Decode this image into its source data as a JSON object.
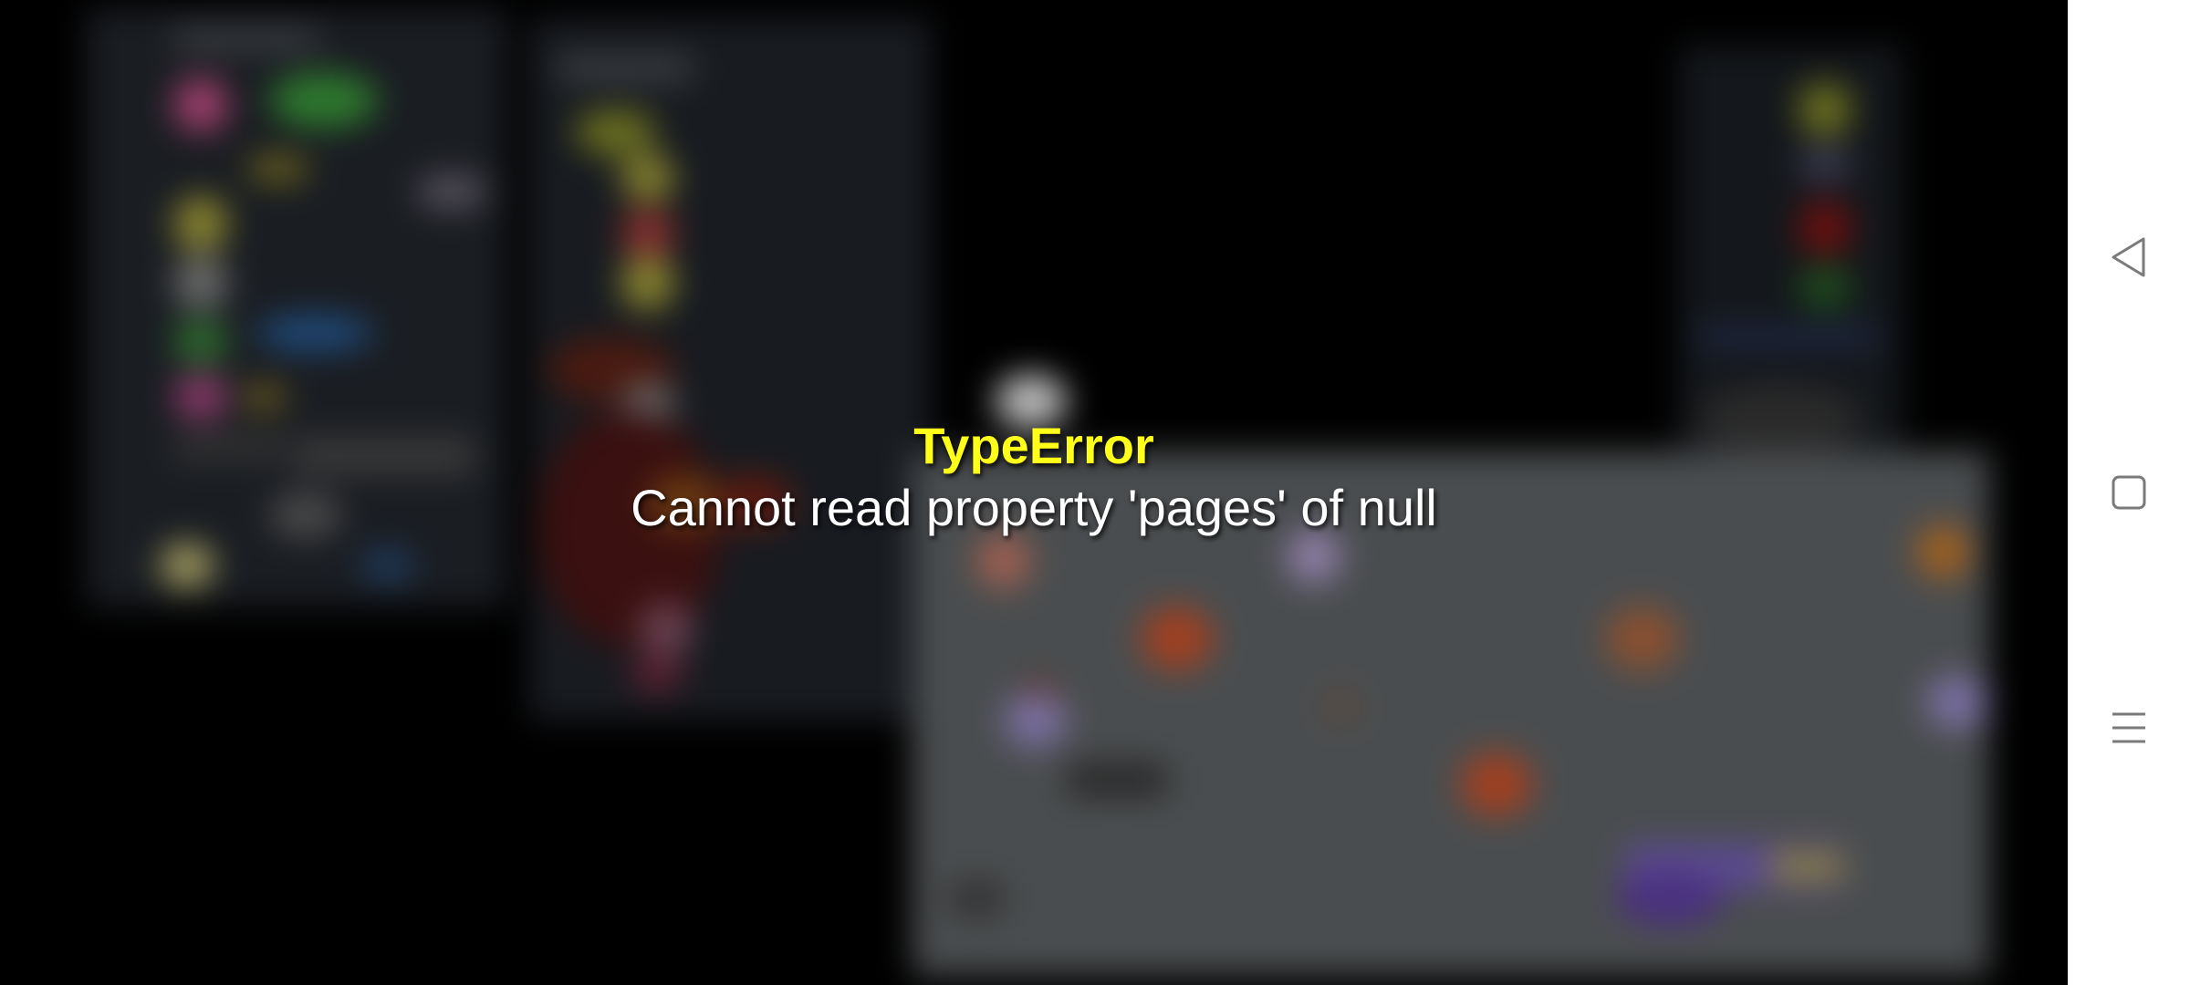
{
  "error": {
    "title": "TypeError",
    "message": "Cannot read property 'pages' of null",
    "title_color": "#ffff1a",
    "message_color": "#ffffff"
  },
  "nav_bar": {
    "buttons": [
      {
        "name": "back",
        "icon": "back-triangle-icon"
      },
      {
        "name": "home",
        "icon": "home-square-icon"
      },
      {
        "name": "recents",
        "icon": "menu-lines-icon"
      }
    ],
    "background": "#ffffff",
    "icon_color": "#7a7a7a"
  },
  "background": {
    "color": "#000000",
    "blurred": true
  }
}
